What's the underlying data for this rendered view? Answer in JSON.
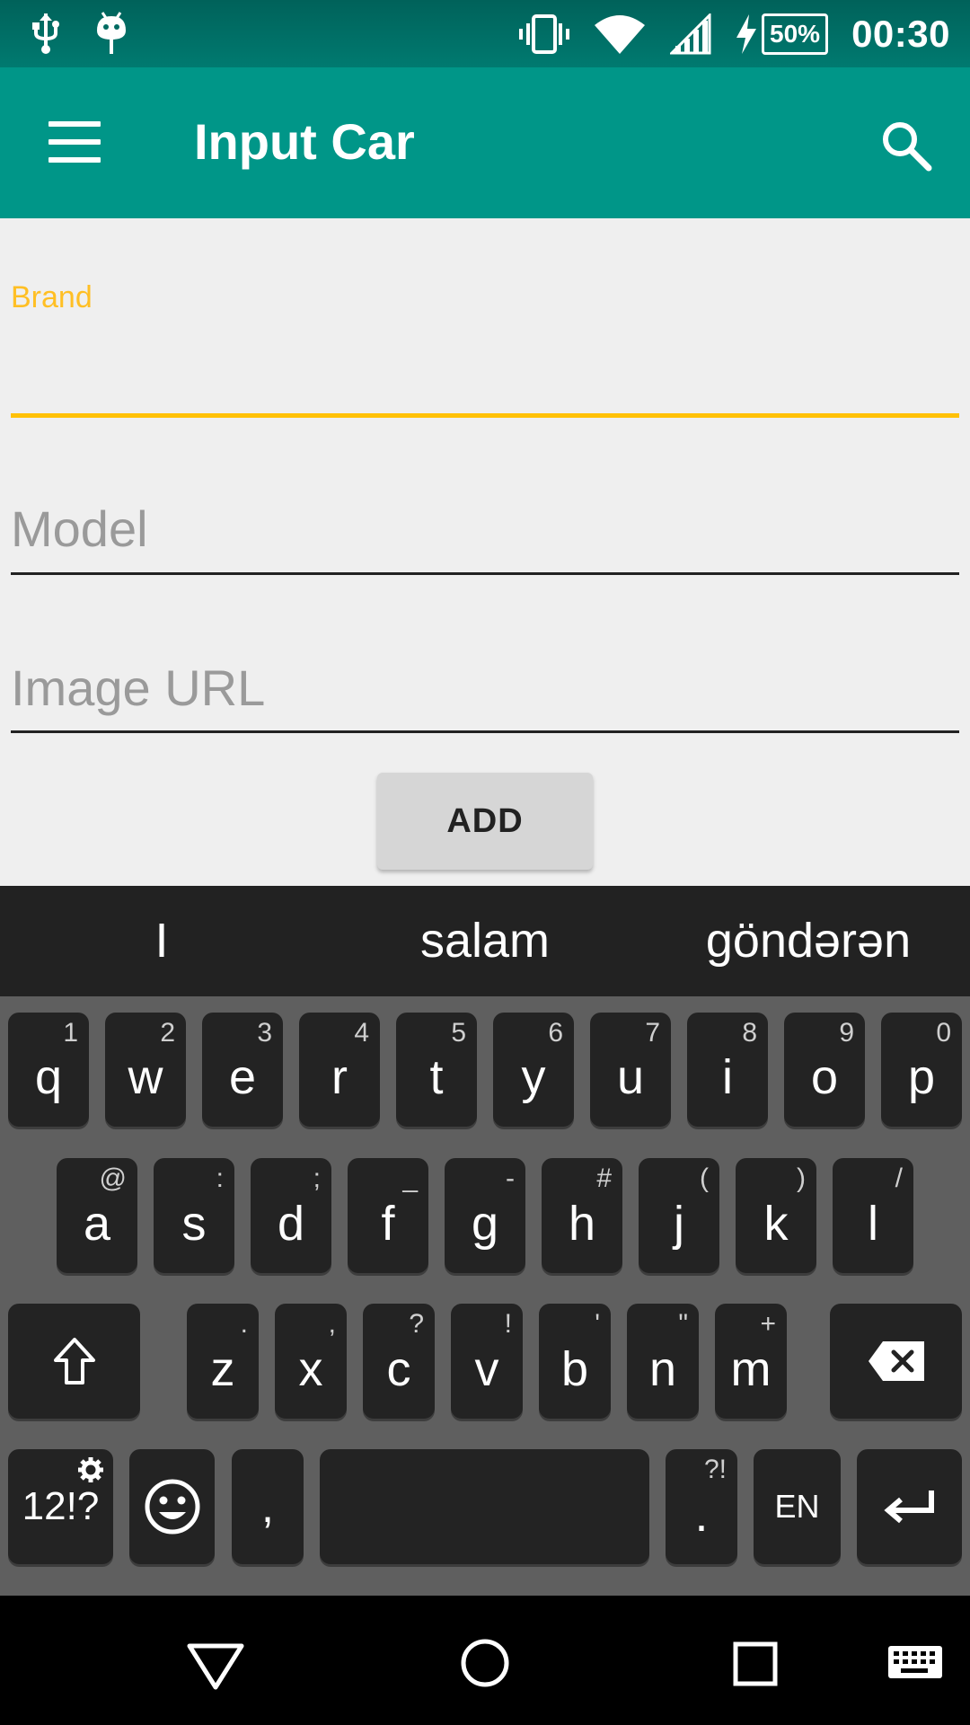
{
  "status_bar": {
    "time": "00:30",
    "battery": "50%",
    "icons": [
      "usb-icon",
      "android-icon",
      "vibrate-icon",
      "wifi-icon",
      "signal-icon",
      "charging-icon"
    ]
  },
  "app_bar": {
    "title": "Input Car",
    "icons": [
      "menu-icon",
      "search-icon"
    ],
    "color": "#009688"
  },
  "form": {
    "brand": {
      "label": "Brand",
      "value": ""
    },
    "model": {
      "placeholder": "Model",
      "value": ""
    },
    "image_url": {
      "placeholder": "Image URL",
      "value": ""
    },
    "add_button": "ADD",
    "accent_color": "#ffc107"
  },
  "keyboard": {
    "suggestions": [
      "I",
      "salam",
      "göndərən"
    ],
    "row1": [
      {
        "key": "q",
        "hint": "1"
      },
      {
        "key": "w",
        "hint": "2"
      },
      {
        "key": "e",
        "hint": "3"
      },
      {
        "key": "r",
        "hint": "4"
      },
      {
        "key": "t",
        "hint": "5"
      },
      {
        "key": "y",
        "hint": "6"
      },
      {
        "key": "u",
        "hint": "7"
      },
      {
        "key": "i",
        "hint": "8"
      },
      {
        "key": "o",
        "hint": "9"
      },
      {
        "key": "p",
        "hint": "0"
      }
    ],
    "row2": [
      {
        "key": "a",
        "hint": "@"
      },
      {
        "key": "s",
        "hint": ":"
      },
      {
        "key": "d",
        "hint": ";"
      },
      {
        "key": "f",
        "hint": "_"
      },
      {
        "key": "g",
        "hint": "-"
      },
      {
        "key": "h",
        "hint": "#"
      },
      {
        "key": "j",
        "hint": "("
      },
      {
        "key": "k",
        "hint": ")"
      },
      {
        "key": "l",
        "hint": "/"
      }
    ],
    "row3": [
      {
        "key": "z",
        "hint": "."
      },
      {
        "key": "x",
        "hint": ","
      },
      {
        "key": "c",
        "hint": "?"
      },
      {
        "key": "v",
        "hint": "!"
      },
      {
        "key": "b",
        "hint": "'"
      },
      {
        "key": "n",
        "hint": "\""
      },
      {
        "key": "m",
        "hint": "+"
      }
    ],
    "symbols_key": "12!?",
    "comma_key": ",",
    "period_key": ".",
    "period_hint": "?!",
    "language_key": "EN",
    "icons": [
      "shift-icon",
      "backspace-icon",
      "settings-icon",
      "emoji-icon",
      "enter-icon"
    ]
  },
  "nav_bar": {
    "icons": [
      "back-icon",
      "home-icon",
      "recents-icon",
      "keyboard-icon"
    ]
  }
}
